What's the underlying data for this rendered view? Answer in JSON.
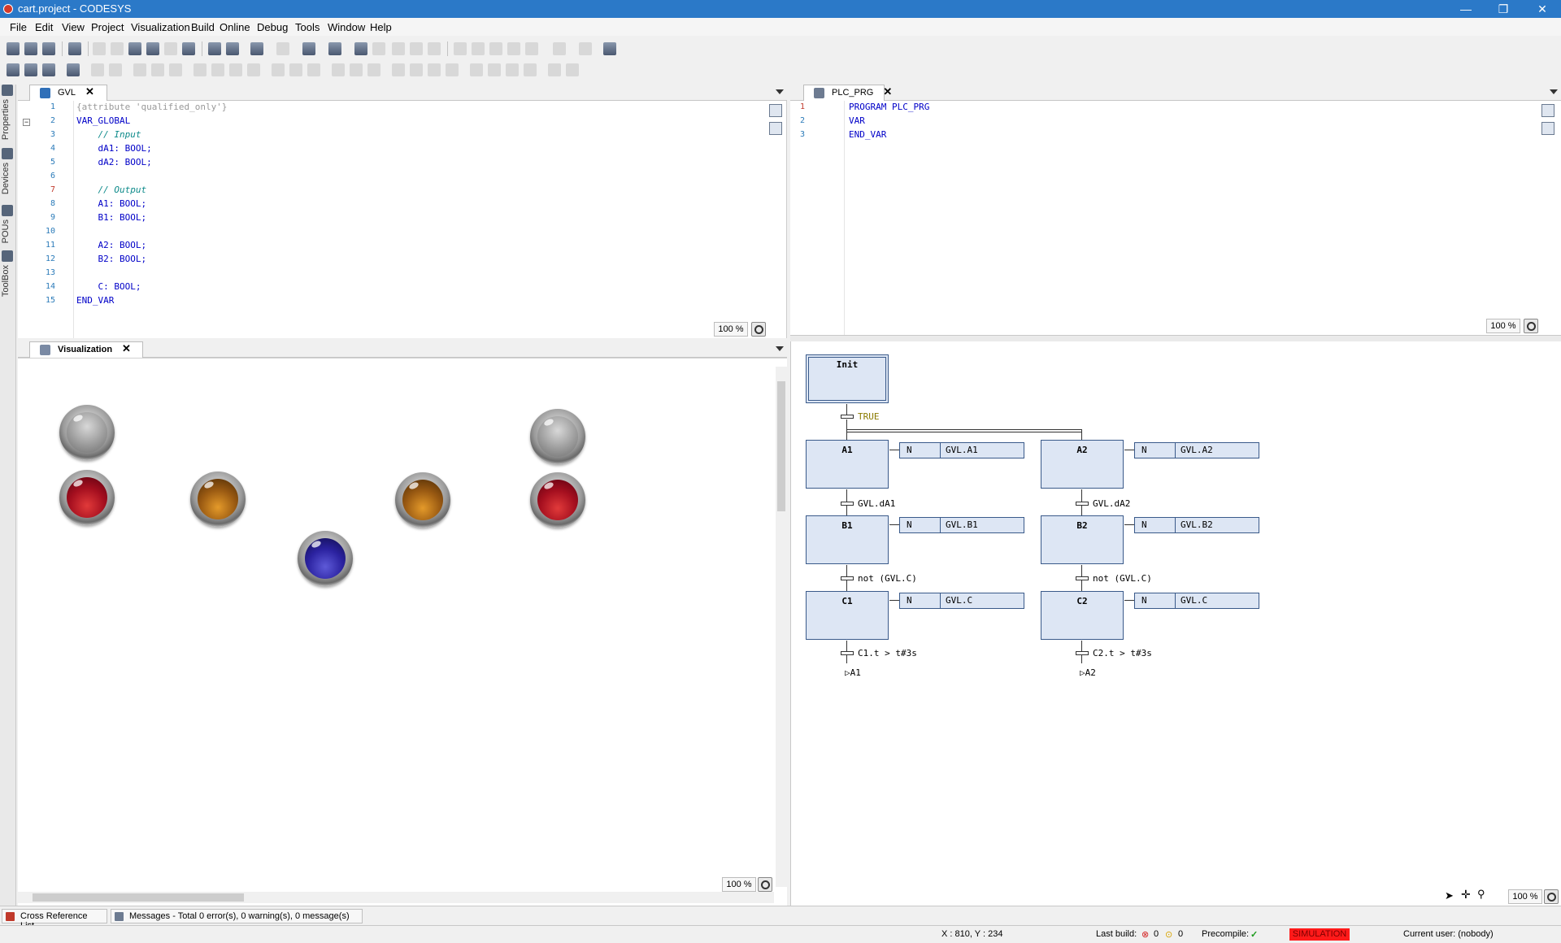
{
  "window": {
    "title": "cart.project - CODESYS",
    "controls": [
      "—",
      "❐",
      "✕"
    ]
  },
  "menu": [
    "File",
    "Edit",
    "View",
    "Project",
    "Visualization",
    "Build",
    "Online",
    "Debug",
    "Tools",
    "Window",
    "Help"
  ],
  "siderail": [
    "Properties",
    "Devices",
    "POUs",
    "ToolBox"
  ],
  "gvl": {
    "tab": "GVL",
    "line_numbers": [
      "1",
      "2",
      "3",
      "4",
      "5",
      "6",
      "7",
      "8",
      "9",
      "10",
      "11",
      "12",
      "13",
      "14",
      "15"
    ],
    "lines": [
      "{attribute 'qualified_only'}",
      "VAR_GLOBAL",
      "    // Input",
      "    dA1: BOOL;",
      "    dA2: BOOL;",
      "",
      "    // Output",
      "    A1: BOOL;",
      "    B1: BOOL;",
      "",
      "    A2: BOOL;",
      "    B2: BOOL;",
      "",
      "    C: BOOL;",
      "END_VAR"
    ],
    "zoom": "100 %"
  },
  "plc_prg": {
    "tab": "PLC_PRG",
    "line_numbers": [
      "1",
      "2",
      "3"
    ],
    "lines": [
      "PROGRAM PLC_PRG",
      "VAR",
      "END_VAR"
    ],
    "zoom": "100 %"
  },
  "visualization": {
    "tab": "Visualization",
    "zoom": "100 %",
    "lamps": [
      {
        "color": "gray"
      },
      {
        "color": "gray"
      },
      {
        "color": "red"
      },
      {
        "color": "brown"
      },
      {
        "color": "brown"
      },
      {
        "color": "red"
      },
      {
        "color": "blue"
      }
    ]
  },
  "sfc": {
    "init_step": "Init",
    "init_transition": "TRUE",
    "branches": [
      {
        "steps": [
          "A1",
          "B1",
          "C1"
        ],
        "actions": [
          {
            "q": "N",
            "name": "GVL.A1"
          },
          {
            "q": "N",
            "name": "GVL.B1"
          },
          {
            "q": "N",
            "name": "GVL.C"
          }
        ],
        "transitions": [
          "GVL.dA1",
          "not (GVL.C)",
          "C1.t > t#3s"
        ],
        "jump": "A1"
      },
      {
        "steps": [
          "A2",
          "B2",
          "C2"
        ],
        "actions": [
          {
            "q": "N",
            "name": "GVL.A2"
          },
          {
            "q": "N",
            "name": "GVL.B2"
          },
          {
            "q": "N",
            "name": "GVL.C"
          }
        ],
        "transitions": [
          "GVL.dA2",
          "not (GVL.C)",
          "C2.t > t#3s"
        ],
        "jump": "A2"
      }
    ],
    "zoom": "100 %"
  },
  "bottom_tabs": [
    "Cross Reference List",
    "Messages - Total 0 error(s), 0 warning(s), 0 message(s)"
  ],
  "status": {
    "coords": "X : 810, Y : 234",
    "last_build_label": "Last build:",
    "errors": "0",
    "warnings": "0",
    "precompile_label": "Precompile:",
    "mode": "SIMULATION",
    "user": "Current user: (nobody)"
  },
  "colors": {
    "titlebar": "#2b79c8",
    "simulation": "#ff1a1a",
    "keyword": "#0000c8",
    "comment": "#0d8a8a",
    "step_fill": "#dde6f4"
  }
}
